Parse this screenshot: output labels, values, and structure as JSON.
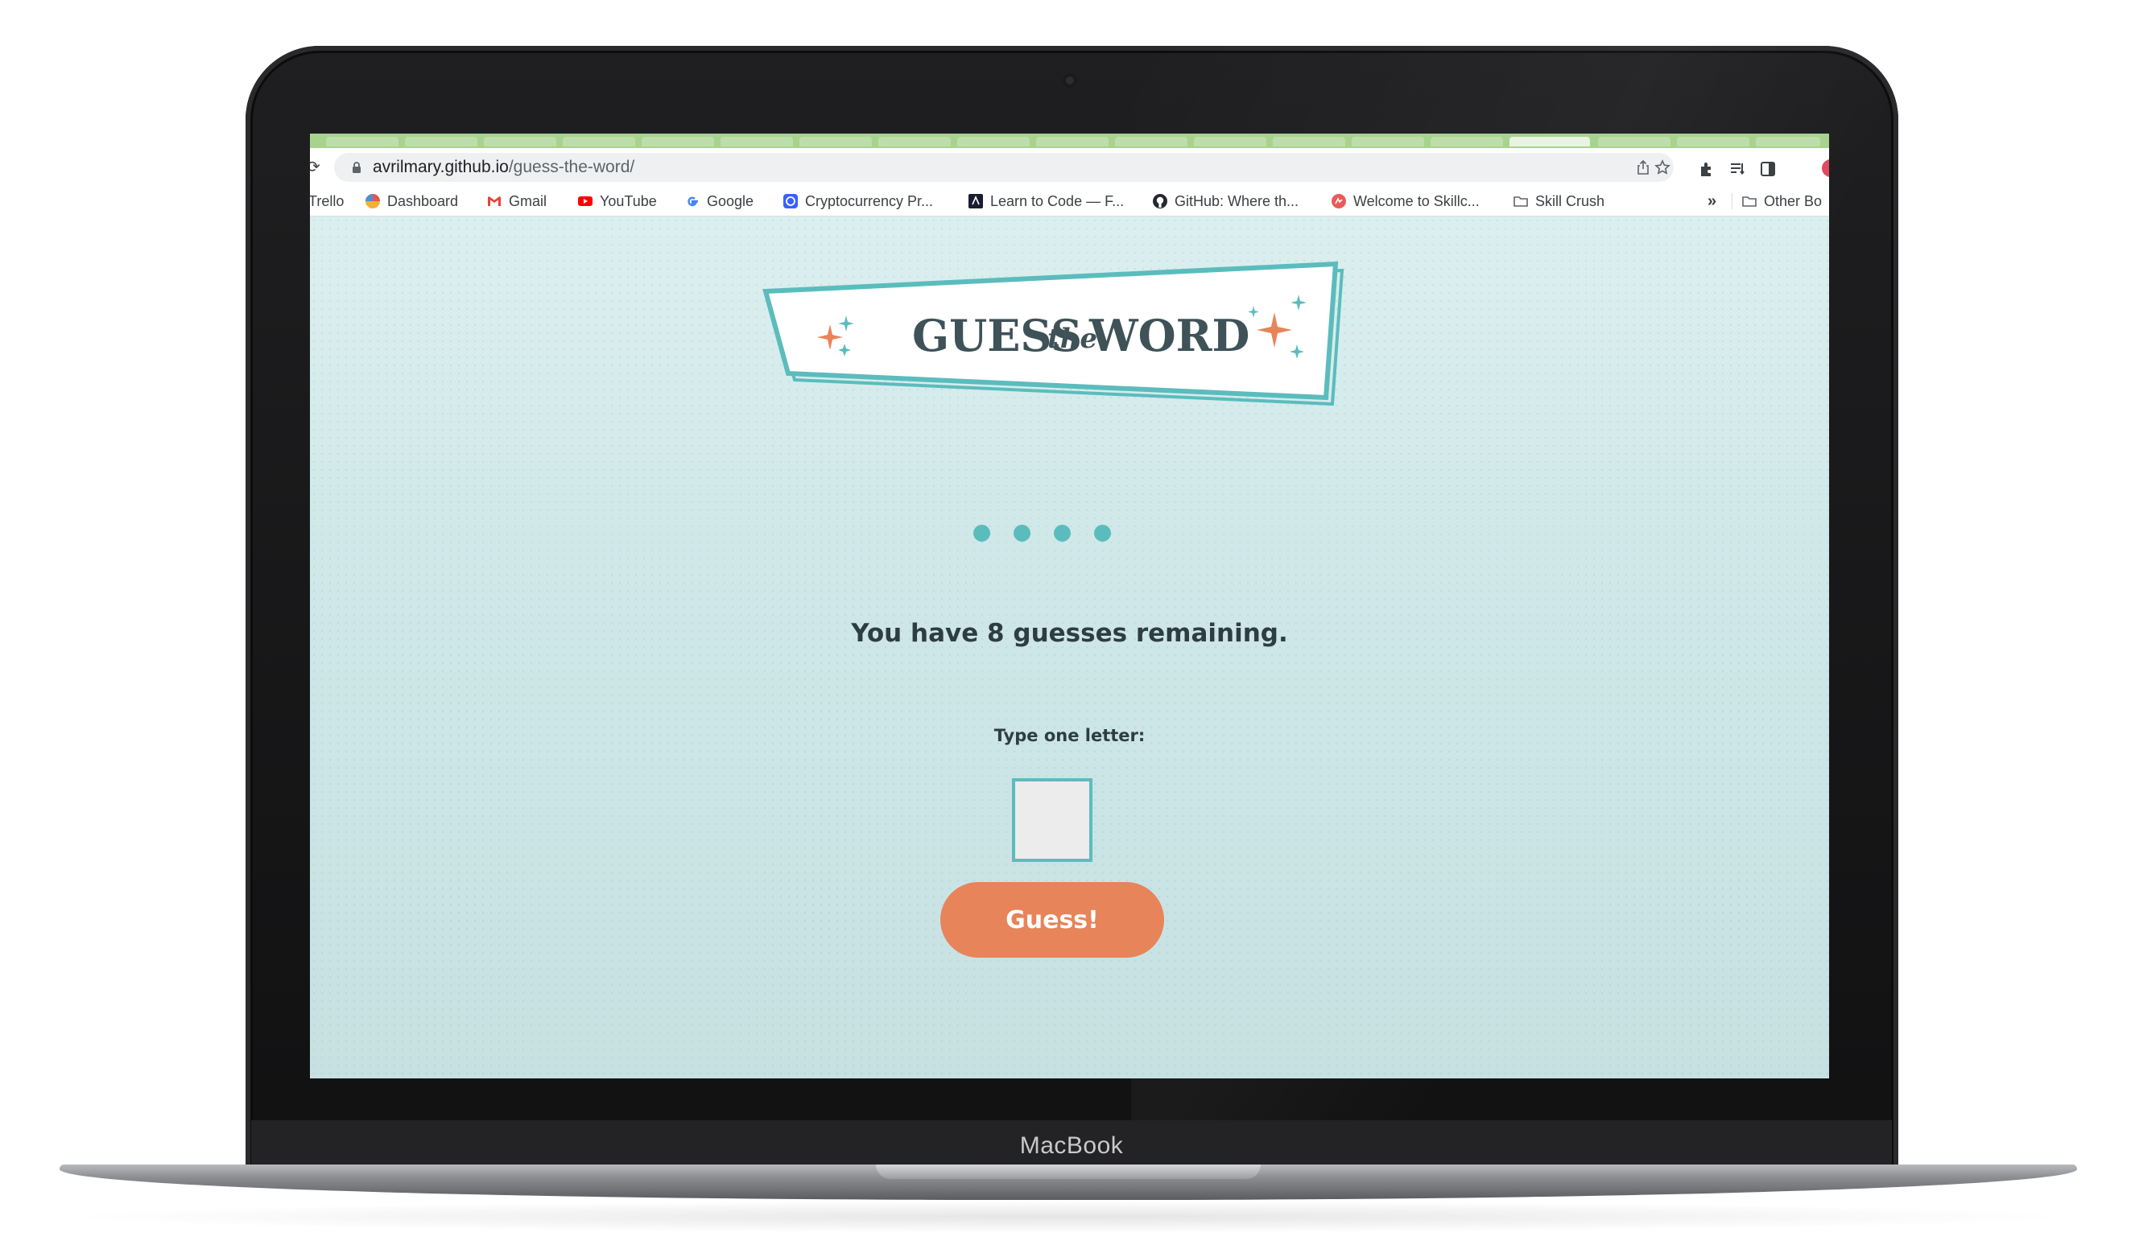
{
  "browser": {
    "url_host": "avrilmary.github.io",
    "url_path": "/guess-the-word/",
    "bookmarks": [
      {
        "label": "Trello",
        "icon": "trello-icon"
      },
      {
        "label": "Dashboard",
        "icon": "dashboard-icon"
      },
      {
        "label": "Gmail",
        "icon": "gmail-icon"
      },
      {
        "label": "YouTube",
        "icon": "youtube-icon"
      },
      {
        "label": "Google",
        "icon": "google-icon"
      },
      {
        "label": "Cryptocurrency Pr...",
        "icon": "crypto-icon"
      },
      {
        "label": "Learn to Code — F...",
        "icon": "freecodecamp-icon"
      },
      {
        "label": "GitHub: Where th...",
        "icon": "github-icon"
      },
      {
        "label": "Welcome to Skillc...",
        "icon": "skillcrush-icon"
      },
      {
        "label": "Skill Crush",
        "icon": "folder-icon"
      },
      {
        "label": "Other Bo",
        "icon": "folder-icon"
      }
    ],
    "more_label": "»"
  },
  "game": {
    "logo": {
      "word1": "GUESS",
      "word2": "the",
      "word3": "WORD"
    },
    "word_in_progress": [
      "●",
      "●",
      "●",
      "●"
    ],
    "remaining_text": "You have 8 guesses remaining.",
    "input_label": "Type one letter:",
    "input_value": "",
    "button_label": "Guess!"
  },
  "device": {
    "brand": "MacBook"
  },
  "colors": {
    "accent_teal": "#5bbcbd",
    "button_orange": "#e8845a",
    "text_dark": "#2e3d44",
    "tab_green": "#a7d38f"
  }
}
